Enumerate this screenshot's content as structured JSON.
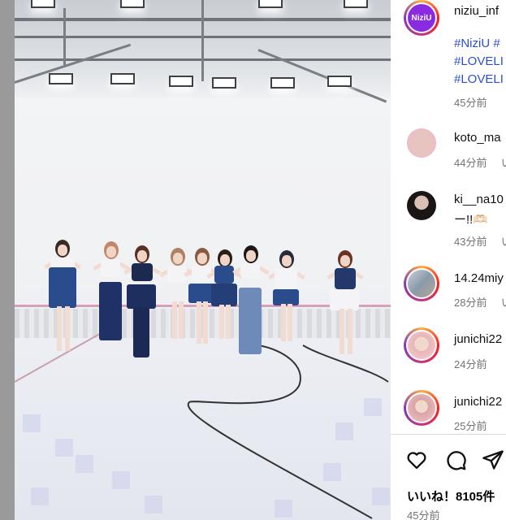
{
  "post": {
    "author": "niziu_inf",
    "author_avatar_text": "NiziU",
    "caption_tags": [
      "#NiziU #",
      "#LOVELI",
      "#LOVELI"
    ],
    "caption_time": "45分前"
  },
  "comments": [
    {
      "username": "koto_ma",
      "text": "",
      "time": "44分前",
      "reply_label": "い"
    },
    {
      "username": "ki__na10",
      "text": "ー!!🫶🏻",
      "time": "43分前",
      "reply_label": "い"
    },
    {
      "username": "14.24miy",
      "text": "",
      "time": "28分前",
      "reply_label": "い"
    },
    {
      "username": "junichi22",
      "text": "",
      "time": "24分前",
      "reply_label": ""
    },
    {
      "username": "junichi22",
      "text": "",
      "time": "25分前",
      "reply_label": ""
    }
  ],
  "actions": {
    "likes": "いいね！8105件",
    "post_time": "45分前",
    "icons": [
      "heart-icon",
      "comment-icon",
      "share-icon"
    ]
  },
  "colors": {
    "hashtag": "#2b4fd0",
    "meta": "#737373",
    "story_ring": "#c13584",
    "logo": "#8a2be2"
  }
}
